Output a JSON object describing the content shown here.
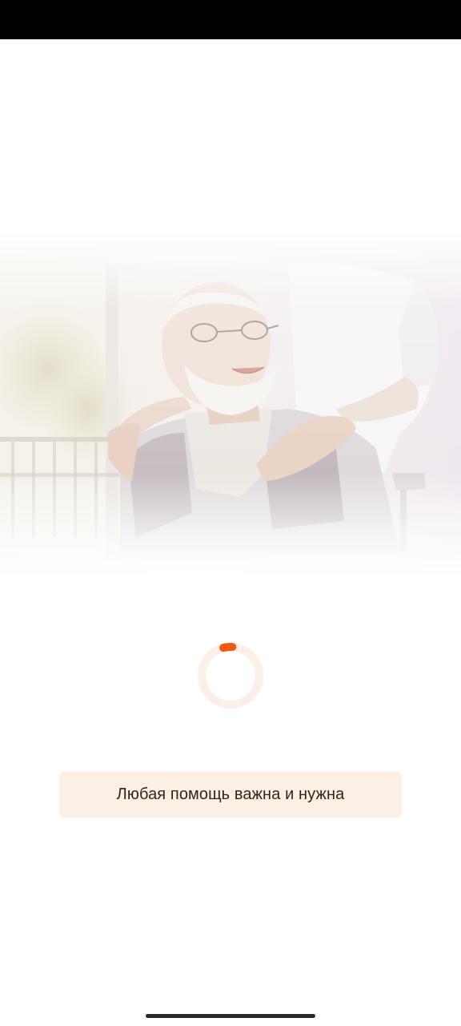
{
  "colors": {
    "status_bar": "#000000",
    "background": "#ffffff",
    "accent": "#f05a0f",
    "spinner_track": "#fcefe8",
    "card_background": "#fcefe6",
    "card_text": "#3b1f10",
    "home_indicator": "#2b2b2b"
  },
  "hero": {
    "image_icon": "elderly-man-with-caregiver-illustration"
  },
  "loader": {
    "icon": "loading-spinner-icon",
    "progress": 0.05
  },
  "message": {
    "text": "Любая помощь важна и нужна"
  }
}
